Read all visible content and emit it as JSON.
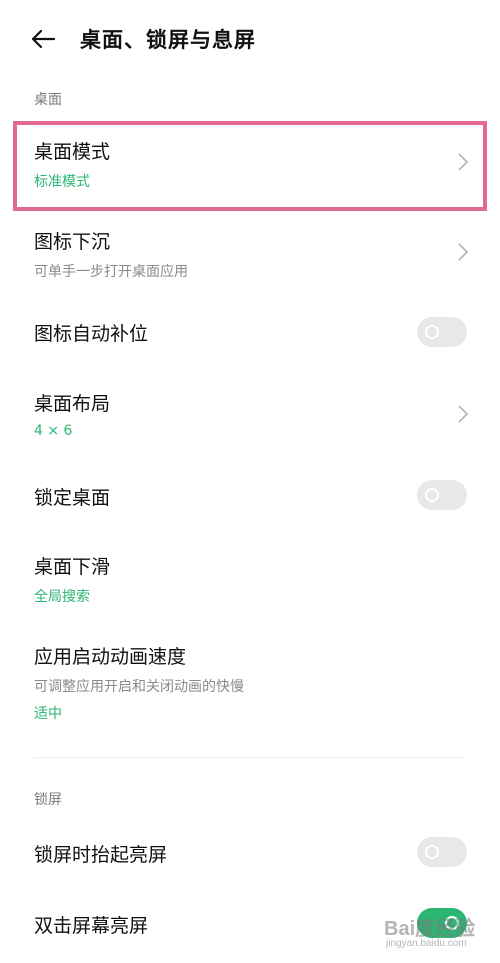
{
  "header": {
    "title": "桌面、锁屏与息屏"
  },
  "sections": {
    "desktop_label": "桌面",
    "lockscreen_label": "锁屏"
  },
  "rows": {
    "desktop_mode": {
      "title": "桌面模式",
      "value": "标准模式"
    },
    "icon_sink": {
      "title": "图标下沉",
      "description": "可单手一步打开桌面应用"
    },
    "icon_auto_fill": {
      "title": "图标自动补位",
      "enabled": false
    },
    "desktop_layout": {
      "title": "桌面布局",
      "value": "4 × 6"
    },
    "lock_desktop": {
      "title": "锁定桌面",
      "enabled": false
    },
    "desktop_swipe_down": {
      "title": "桌面下滑",
      "value": "全局搜索"
    },
    "app_launch_speed": {
      "title": "应用启动动画速度",
      "description": "可调整应用开启和关闭动画的快慢",
      "value": "适中"
    },
    "raise_to_wake": {
      "title": "锁屏时抬起亮屏",
      "enabled": false
    },
    "double_tap_wake": {
      "title": "双击屏幕亮屏",
      "enabled": true
    }
  },
  "colors": {
    "accent_green": "#2bb673",
    "highlight_pink": "#e06a93",
    "toggle_off": "#e8e8e8"
  },
  "icons": {
    "back": "arrow-left-icon",
    "chevron": "chevron-right-icon"
  },
  "watermark": {
    "text": "Bai度经验",
    "sub": "jingyan.baidu.com"
  }
}
